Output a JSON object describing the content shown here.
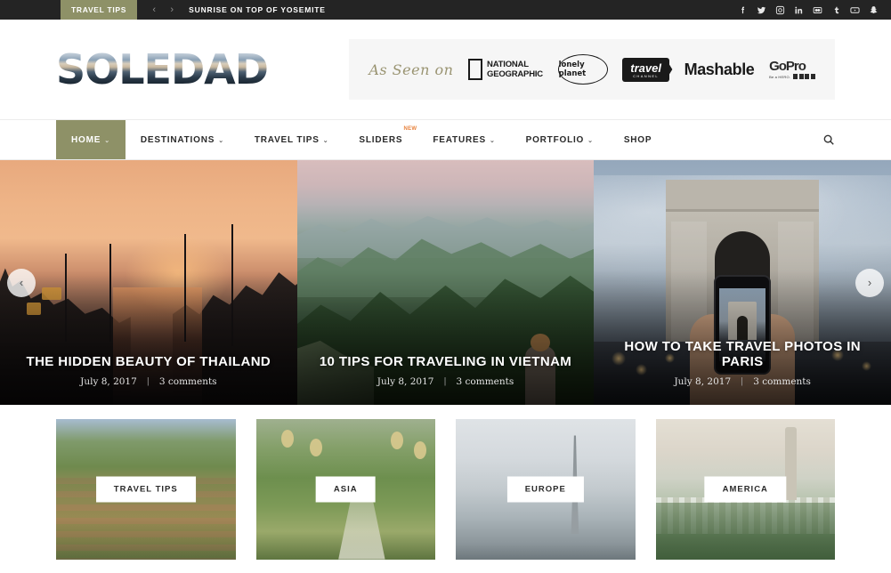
{
  "topbar": {
    "category_label": "TRAVEL TIPS",
    "prev_arrow": "‹",
    "next_arrow": "›",
    "headline": "SUNRISE ON TOP OF YOSEMITE",
    "social": [
      {
        "name": "facebook-icon"
      },
      {
        "name": "twitter-icon"
      },
      {
        "name": "instagram-icon"
      },
      {
        "name": "linkedin-icon"
      },
      {
        "name": "flickr-icon"
      },
      {
        "name": "tumblr-icon"
      },
      {
        "name": "youtube-icon"
      },
      {
        "name": "snapchat-icon"
      }
    ]
  },
  "header": {
    "logo_text": "SOLEDAD",
    "seen_on": {
      "script_label": "As Seen on",
      "brands": [
        {
          "name": "national-geographic",
          "line1": "NATIONAL",
          "line2": "GEOGRAPHIC"
        },
        {
          "name": "lonely-planet",
          "label": "lonely planet"
        },
        {
          "name": "travel-channel",
          "label": "travel",
          "sub": "CHANNEL"
        },
        {
          "name": "mashable",
          "label": "Mashable"
        },
        {
          "name": "gopro",
          "label": "GoPro",
          "sub": "Be a HERO."
        }
      ]
    }
  },
  "nav": {
    "items": [
      {
        "label": "HOME",
        "has_dropdown": true,
        "active": true,
        "badge": ""
      },
      {
        "label": "DESTINATIONS",
        "has_dropdown": true,
        "active": false,
        "badge": ""
      },
      {
        "label": "TRAVEL TIPS",
        "has_dropdown": true,
        "active": false,
        "badge": ""
      },
      {
        "label": "SLIDERS",
        "has_dropdown": false,
        "active": false,
        "badge": "NEW"
      },
      {
        "label": "FEATURES",
        "has_dropdown": true,
        "active": false,
        "badge": ""
      },
      {
        "label": "PORTFOLIO",
        "has_dropdown": true,
        "active": false,
        "badge": ""
      },
      {
        "label": "SHOP",
        "has_dropdown": false,
        "active": false,
        "badge": ""
      }
    ],
    "chevron": "⌄",
    "search_icon": "search-icon"
  },
  "slider": {
    "prev_label": "‹",
    "next_label": "›",
    "slides": [
      {
        "title": "THE HIDDEN BEAUTY OF THAILAND",
        "date": "July 8, 2017",
        "separator": "|",
        "comments": "3 comments",
        "image_alt": "sunset over canal with stilt houses in Thailand"
      },
      {
        "title": "10 TIPS FOR TRAVELING IN VIETNAM",
        "date": "July 8, 2017",
        "separator": "|",
        "comments": "3 comments",
        "image_alt": "green karst mountains in Vietnam with hiker"
      },
      {
        "title": "HOW TO TAKE TRAVEL PHOTOS IN PARIS",
        "date": "July 8, 2017",
        "separator": "|",
        "comments": "3 comments",
        "image_alt": "hand holding phone photographing Arc de Triomphe"
      }
    ]
  },
  "categories": [
    {
      "label": "TRAVEL TIPS",
      "image_alt": "rice terraces and palms"
    },
    {
      "label": "ASIA",
      "image_alt": "lanterns along a green garden path"
    },
    {
      "label": "EUROPE",
      "image_alt": "Eiffel Tower over the Seine"
    },
    {
      "label": "AMERICA",
      "image_alt": "San Francisco Coit Tower skyline"
    }
  ],
  "colors": {
    "accent_olive": "#8e9167",
    "topbar_dark": "#242424",
    "badge_orange": "#e8823c"
  }
}
